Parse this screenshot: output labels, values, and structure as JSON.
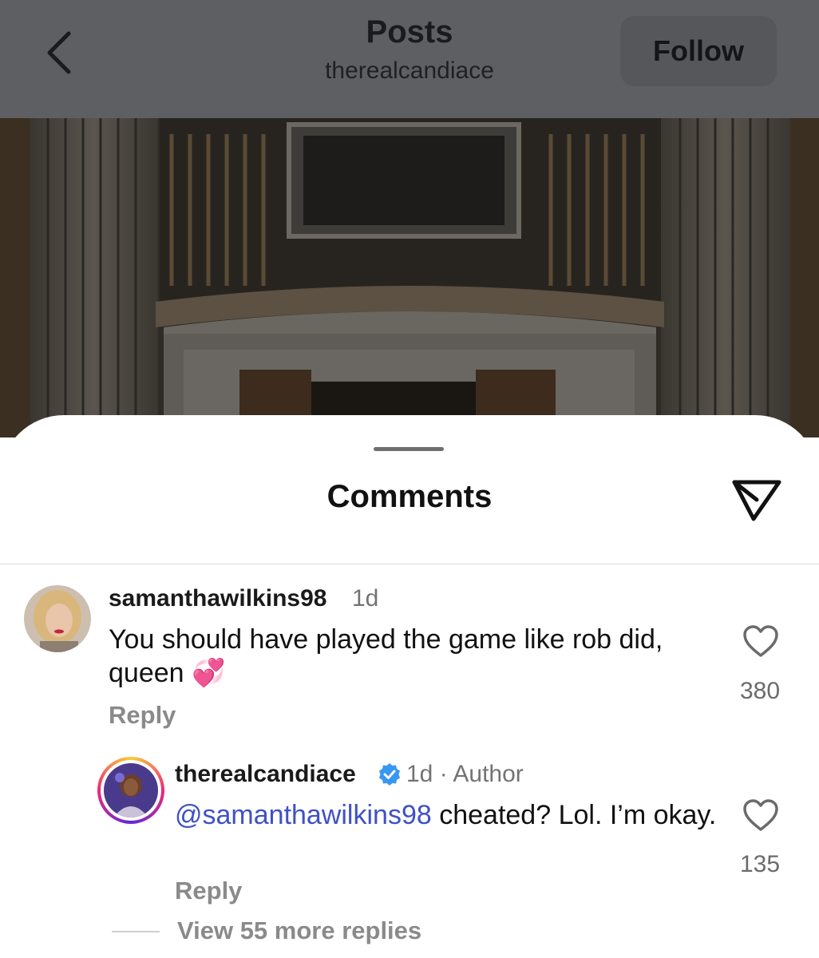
{
  "header": {
    "title": "Posts",
    "subtitle": "therealcandiace",
    "follow_label": "Follow",
    "back_icon": "chevron-left-icon"
  },
  "sheet": {
    "title": "Comments",
    "share_icon": "send-icon"
  },
  "comments": [
    {
      "username": "samanthawilkins98",
      "time": "1d",
      "text": "You should have played the game like rob did, queen",
      "emoji": "💞",
      "reply_label": "Reply",
      "likes": "380"
    }
  ],
  "replies": [
    {
      "username": "therealcandiace",
      "verified": true,
      "time": "1d",
      "separator": "·",
      "tag": "Author",
      "mention": "@samanthawilkins98",
      "text": " cheated? Lol. I’m okay.",
      "reply_label": "Reply",
      "likes": "135"
    }
  ],
  "view_more_label": "View 55 more replies",
  "colors": {
    "mention": "#3f51c5",
    "verified": "#3897f0",
    "secondary_text": "#737373"
  }
}
